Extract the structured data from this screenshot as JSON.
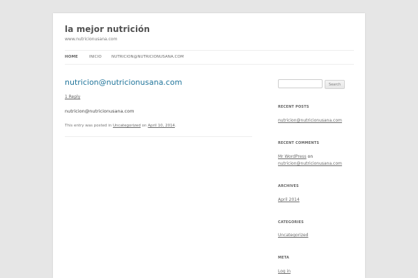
{
  "site": {
    "title": "la mejor nutrición",
    "description": "www.nutricionusana.com"
  },
  "nav": {
    "items": [
      {
        "label": "HOME",
        "active": true
      },
      {
        "label": "INICIO",
        "active": false
      },
      {
        "label": "NUTRICION@NUTRICIONUSANA.COM",
        "active": false
      }
    ]
  },
  "post": {
    "title": "nutricion@nutricionusana.com",
    "reply_link": "1 Reply",
    "content": "nutricion@nutricionusana.com",
    "meta_prefix": "This entry was posted in ",
    "category": "Uncategorized",
    "meta_on": " on ",
    "date": "April 10, 2014",
    "meta_suffix": "."
  },
  "sidebar": {
    "search": {
      "placeholder": "",
      "button_label": "Search"
    },
    "recent_posts": {
      "title": "RECENT POSTS",
      "items": [
        "nutricion@nutricionusana.com"
      ]
    },
    "recent_comments": {
      "title": "RECENT COMMENTS",
      "author": "Mr WordPress",
      "on": " on ",
      "post": "nutricion@nutricionusana.com"
    },
    "archives": {
      "title": "ARCHIVES",
      "items": [
        "April 2014"
      ]
    },
    "categories": {
      "title": "CATEGORIES",
      "items": [
        "Uncategorized"
      ]
    },
    "meta": {
      "title": "META",
      "items": [
        "Log in"
      ]
    }
  },
  "colors": {
    "background": "#e6e6e6",
    "link": "#21759b",
    "page": "#ffffff"
  }
}
